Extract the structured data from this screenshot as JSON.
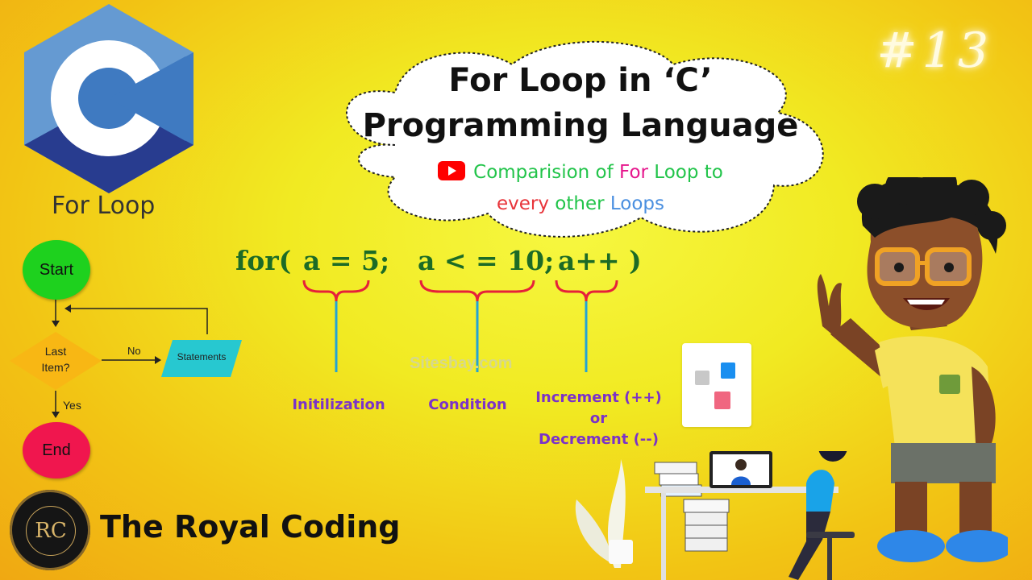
{
  "badge": "#13",
  "logo": {
    "letter": "C",
    "caption": "For Loop"
  },
  "title": {
    "line1": "For Loop in ‘C’",
    "line2": "Programming Language"
  },
  "subtitle": {
    "icon": "youtube-play-icon",
    "line1": [
      {
        "text": "Comparision of ",
        "color": "#22c44a"
      },
      {
        "text": "For",
        "color": "#e6168c"
      },
      {
        "text": " Loop to",
        "color": "#22c44a"
      }
    ],
    "line2": [
      {
        "text": "every",
        "color": "#e8353b"
      },
      {
        "text": " other ",
        "color": "#22c44a"
      },
      {
        "text": "Loops",
        "color": "#4a8fe0"
      }
    ]
  },
  "code": {
    "keyword": "for(",
    "init": "a = 5;",
    "condition": "a < = 10;",
    "increment": "a++ )"
  },
  "labels": {
    "init": "Initilization",
    "condition": "Condition",
    "increment_line1": "Increment (++)",
    "increment_or": "or",
    "increment_line2": "Decrement  (--)"
  },
  "watermark": "Sitesbay.com",
  "flowchart": {
    "start": "Start",
    "decision_line1": "Last",
    "decision_line2": "Item?",
    "no": "No",
    "statements": "Statements",
    "yes": "Yes",
    "end": "End"
  },
  "brand": {
    "name": "The Royal Coding",
    "monogram": "RC"
  },
  "colors": {
    "c_light": "#659ad2",
    "c_mid": "#3f7ac1",
    "c_dark": "#283c8f",
    "start_green": "#1ed11e",
    "end_red": "#f0164e",
    "statement_cyan": "#27c8d0",
    "decision_orange": "#f8b714"
  }
}
